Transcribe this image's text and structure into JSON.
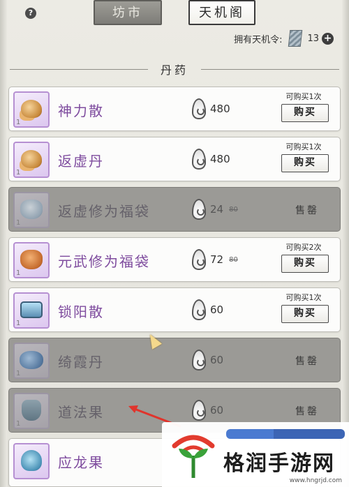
{
  "header": {
    "help_glyph": "?",
    "tabs": [
      {
        "label": "坊市",
        "state": "inactive"
      },
      {
        "label": "天机阁",
        "state": "active"
      }
    ],
    "token_label": "拥有天机令:",
    "token_count": "13",
    "token_icon": "token-scroll-icon",
    "add_glyph": "+"
  },
  "section": {
    "title": "丹药"
  },
  "items": [
    {
      "name": "神力散",
      "price": "480",
      "original_price": "",
      "limit": "可购买1次",
      "action": "购买",
      "status": "available",
      "qty": "1",
      "icon": "snail-icon"
    },
    {
      "name": "返虚丹",
      "price": "480",
      "original_price": "",
      "limit": "可购买1次",
      "action": "购买",
      "status": "available",
      "qty": "1",
      "icon": "snail-icon"
    },
    {
      "name": "返虚修为福袋",
      "price": "24",
      "original_price": "80",
      "limit": "",
      "action": "售罄",
      "status": "sold_out",
      "qty": "1",
      "icon": "blue-bag-icon"
    },
    {
      "name": "元武修为福袋",
      "price": "72",
      "original_price": "80",
      "limit": "可购买2次",
      "action": "购买",
      "status": "available",
      "qty": "1",
      "icon": "orange-bag-icon"
    },
    {
      "name": "锁阳散",
      "price": "60",
      "original_price": "",
      "limit": "可购买1次",
      "action": "购买",
      "status": "available",
      "qty": "1",
      "icon": "chest-icon"
    },
    {
      "name": "绮霞丹",
      "price": "60",
      "original_price": "",
      "limit": "",
      "action": "售罄",
      "status": "sold_out",
      "qty": "1",
      "icon": "cloud-icon"
    },
    {
      "name": "道法果",
      "price": "60",
      "original_price": "",
      "limit": "",
      "action": "售罄",
      "status": "sold_out",
      "qty": "1",
      "icon": "fruit-icon"
    },
    {
      "name": "应龙果",
      "price": "",
      "original_price": "",
      "limit": "",
      "action": "",
      "status": "available",
      "qty": "",
      "icon": "dragon-icon"
    }
  ],
  "watermark": {
    "text": "格润手游网",
    "url": "www.hngrjd.com"
  },
  "colors": {
    "item_name": "#7e4b9e",
    "sold_background": "#9b9a96",
    "annotation_arrow": "#e0342c"
  }
}
